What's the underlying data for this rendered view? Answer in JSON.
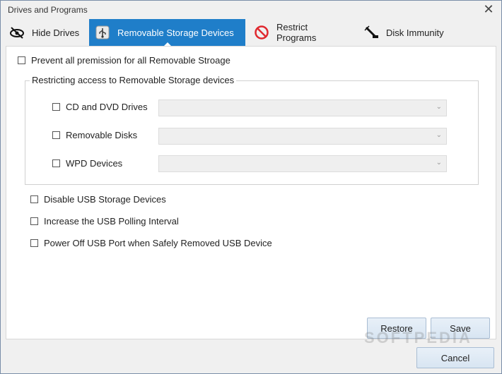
{
  "window": {
    "title": "Drives and Programs",
    "close_glyph": "✕"
  },
  "tabs": [
    {
      "label": "Hide Drives",
      "icon": "hidden-eye-icon"
    },
    {
      "label": "Removable Storage Devices",
      "icon": "usb-icon",
      "active": true
    },
    {
      "label": "Restrict Programs",
      "icon": "no-entry-icon"
    },
    {
      "label": "Disk Immunity",
      "icon": "syringe-icon"
    }
  ],
  "main": {
    "prevent_all_label": "Prevent all premission for all Removable Stroage",
    "group_title": "Restricting access to Removable Storage devices",
    "devices": [
      {
        "label": "CD and DVD Drives",
        "value": ""
      },
      {
        "label": "Removable Disks",
        "value": ""
      },
      {
        "label": "WPD Devices",
        "value": ""
      }
    ],
    "options": [
      "Disable USB Storage Devices",
      "Increase the USB Polling Interval",
      "Power Off USB Port when Safely Removed USB Device"
    ]
  },
  "buttons": {
    "restore": "Restore",
    "save": "Save",
    "cancel": "Cancel"
  },
  "watermark": "SOFTPEDIA",
  "colors": {
    "accent": "#1f7ec9",
    "restrict": "#e0282e"
  }
}
